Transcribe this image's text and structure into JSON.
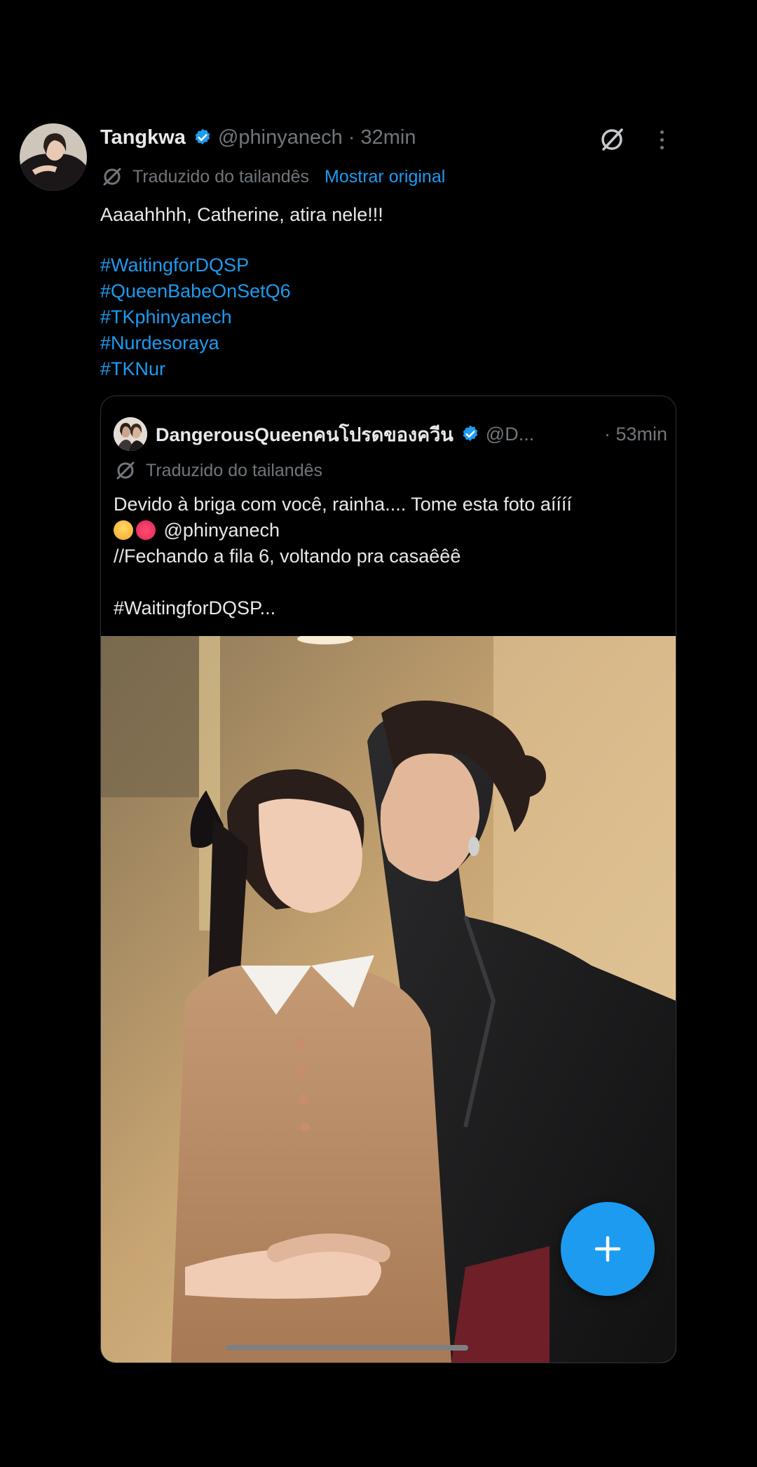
{
  "tweet": {
    "author_name": "Tangkwa",
    "handle_time": "@phinyanech · 32min",
    "translated_label": "Traduzido do tailandês",
    "show_original": "Mostrar original",
    "text": "Aaaahhhh, Catherine, atira nele!!!",
    "hashtags": [
      "#WaitingforDQSP",
      "#QueenBabeOnSetQ6",
      "#TKphinyanech",
      "#Nurdesoraya",
      "#TKNur"
    ]
  },
  "quote": {
    "author_name": "DangerousQueenคนโปรดของควีน",
    "handle": "@D...",
    "time": "· 53min",
    "translated_label": "Traduzido do tailandês",
    "lines": [
      "Devido à briga com você, rainha.... Tome esta foto aíííí",
      "@phinyanech",
      "//Fechando a fila 6, voltando pra casaêêê",
      "",
      "#WaitingforDQSP..."
    ]
  },
  "icons": {
    "verified": "verified-badge-icon",
    "grok": "grok-icon",
    "more": "more-options-icon",
    "translate": "translate-icon",
    "compose": "compose-plus-icon"
  },
  "colors": {
    "background": "#000000",
    "text": "#e7e9ea",
    "muted": "#71767b",
    "accent": "#1d9bf0"
  }
}
